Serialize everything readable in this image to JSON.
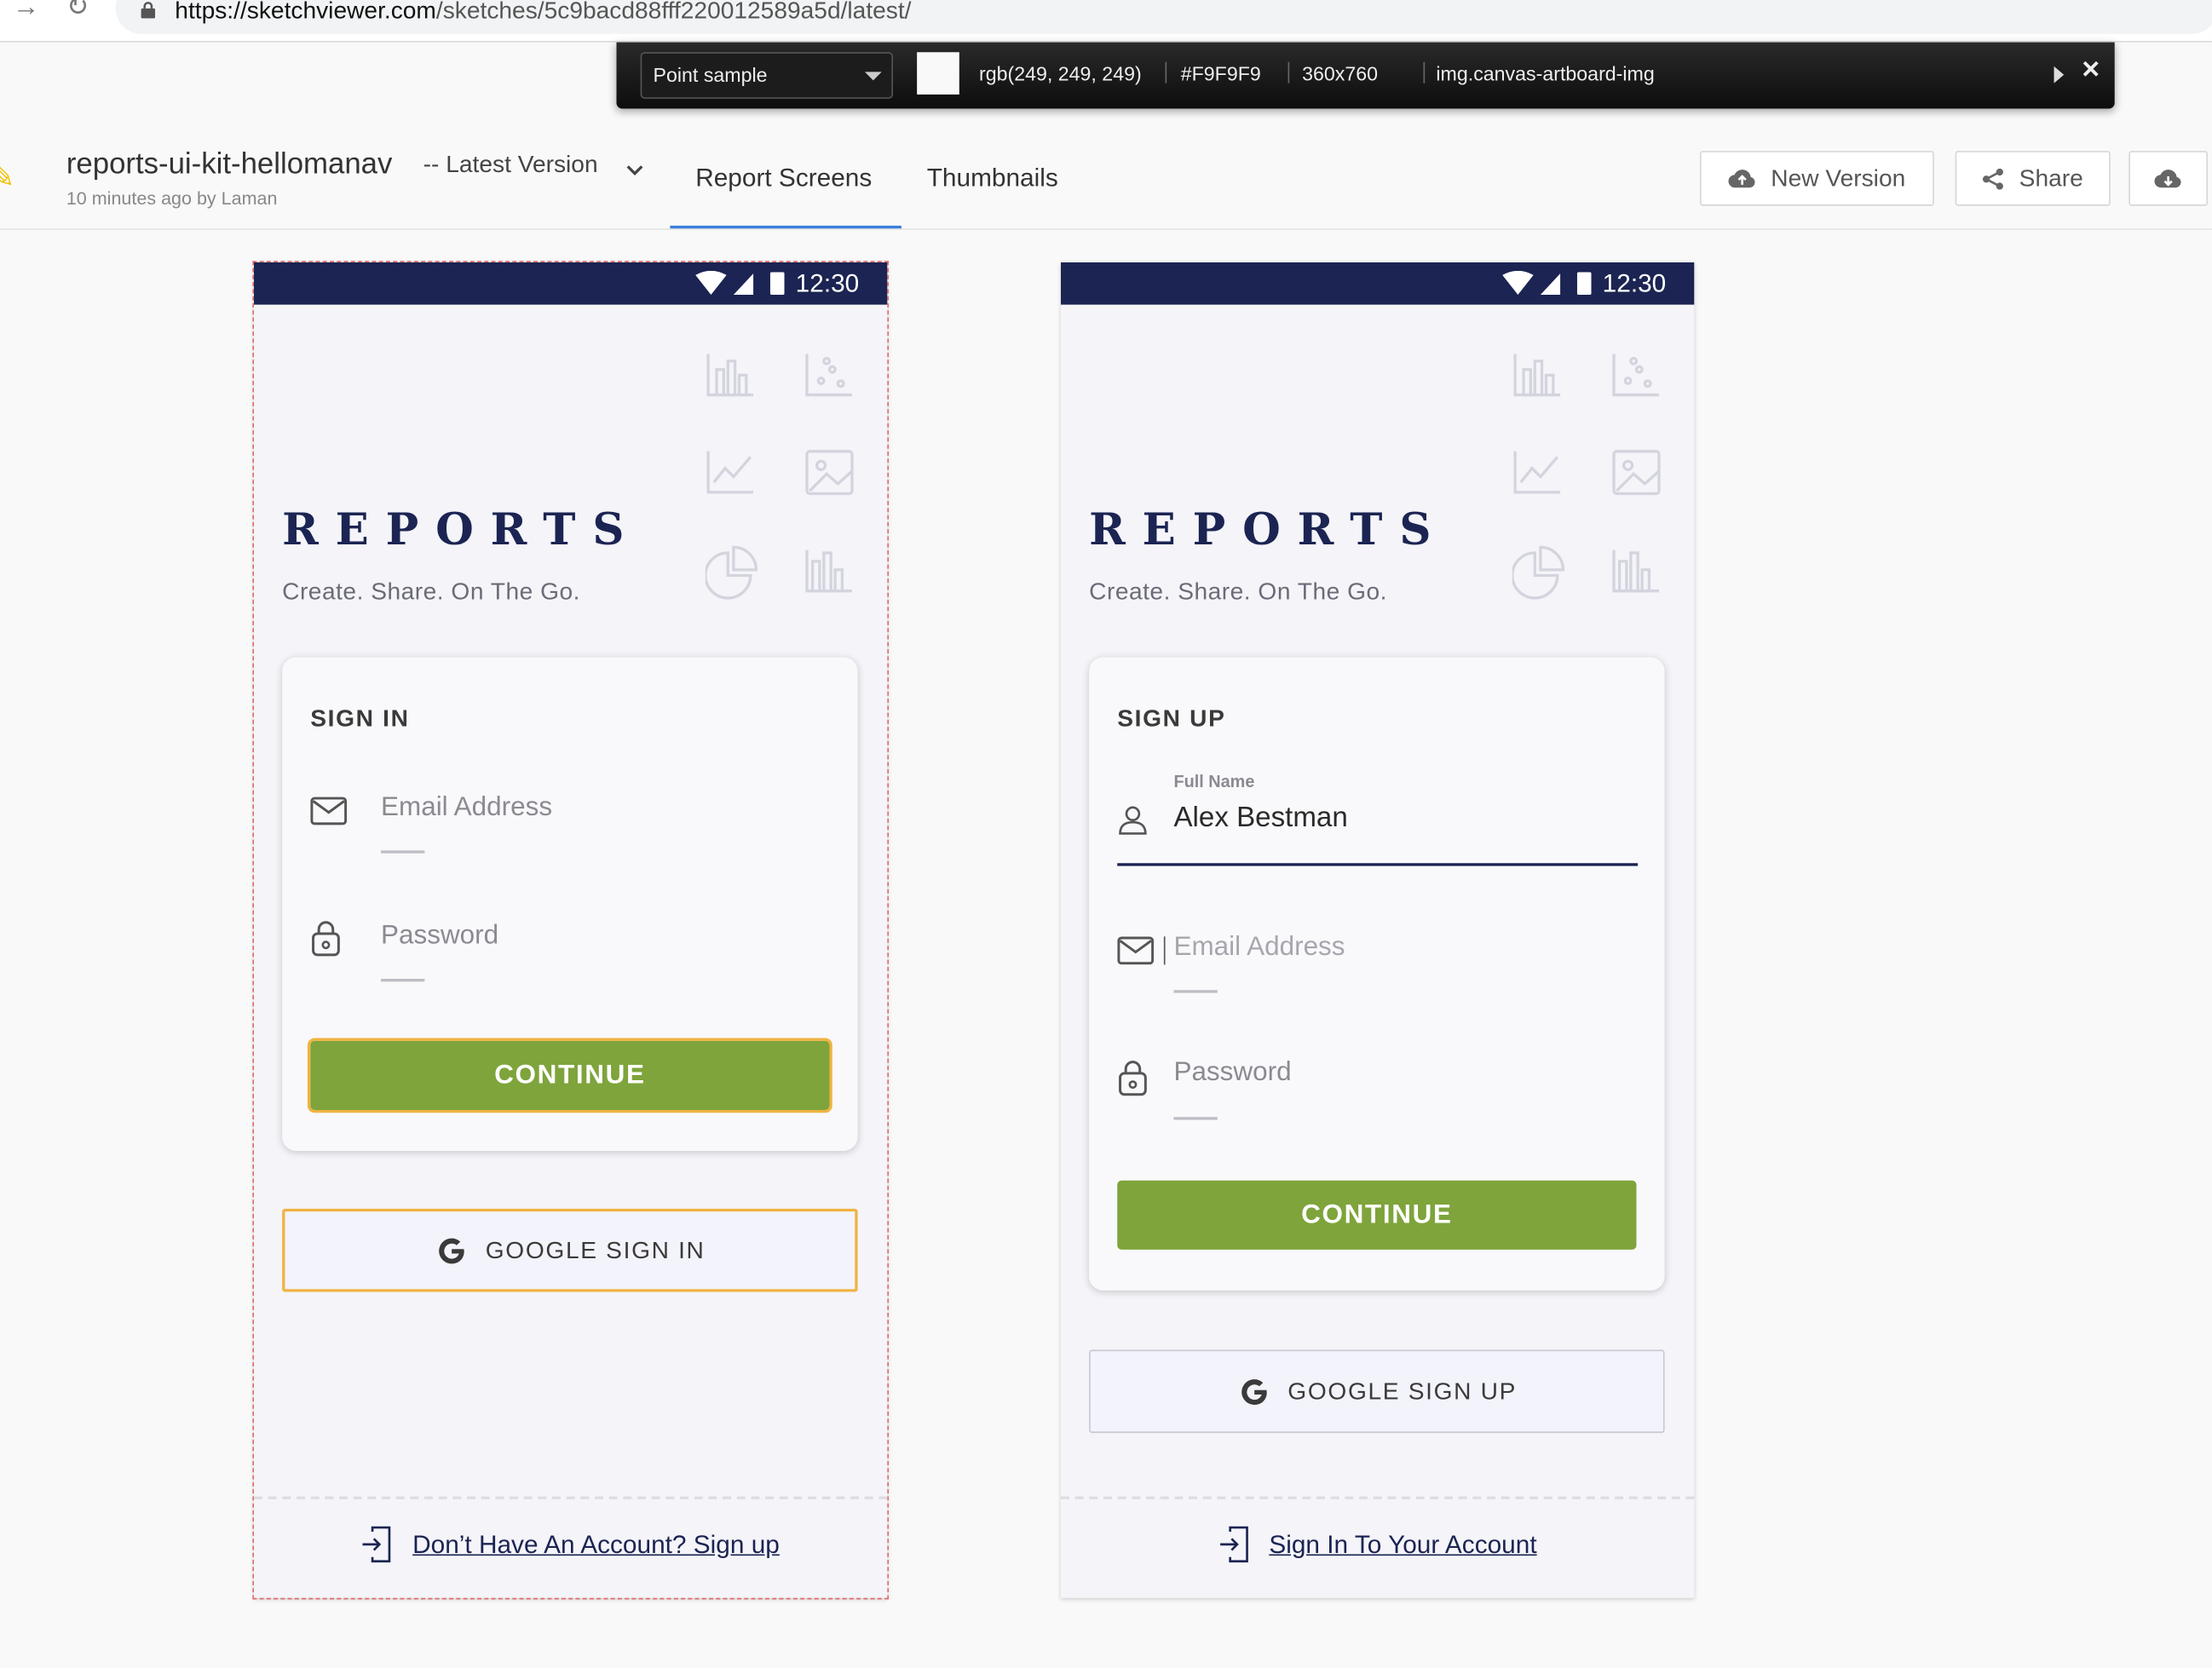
{
  "browser": {
    "url_host": "https://sketchviewer.com",
    "url_path": "/sketches/5c9bacd88fff220012589a5d/latest/"
  },
  "header": {
    "project_title": "reports-ui-kit-hellomanav",
    "version_label": "-- Latest Version",
    "subtitle": "10 minutes ago by Laman",
    "tabs": [
      "Report Screens",
      "Thumbnails"
    ],
    "active_tab": "Report Screens",
    "new_version_label": "New Version",
    "share_label": "Share"
  },
  "inspector": {
    "mode": "Point sample",
    "rgb": "rgb(249, 249, 249)",
    "hex": "#F9F9F9",
    "size": "360x760",
    "selector": "img.canvas-artboard-img",
    "swatch_color": "#F9F9F9"
  },
  "colors": {
    "navy": "#1b2452",
    "green": "#7ea43b",
    "orange_highlight": "#f0b342",
    "selection_red": "#e06c6c"
  },
  "sign_in_screen": {
    "time": "12:30",
    "brand": "REPORTS",
    "tagline": "Create. Share. On The Go.",
    "card_title": "SIGN IN",
    "email_placeholder": "Email Address",
    "password_placeholder": "Password",
    "continue_label": "CONTINUE",
    "google_label": "GOOGLE SIGN IN",
    "footer_link": "Don’t Have An Account? Sign up"
  },
  "sign_up_screen": {
    "time": "12:30",
    "brand": "REPORTS",
    "tagline": "Create. Share. On The Go.",
    "card_title": "SIGN UP",
    "full_name_label": "Full Name",
    "full_name_value": "Alex Bestman",
    "email_placeholder": "Email Address",
    "password_placeholder": "Password",
    "continue_label": "CONTINUE",
    "google_label": "GOOGLE SIGN UP",
    "footer_link": "Sign In To Your Account"
  }
}
